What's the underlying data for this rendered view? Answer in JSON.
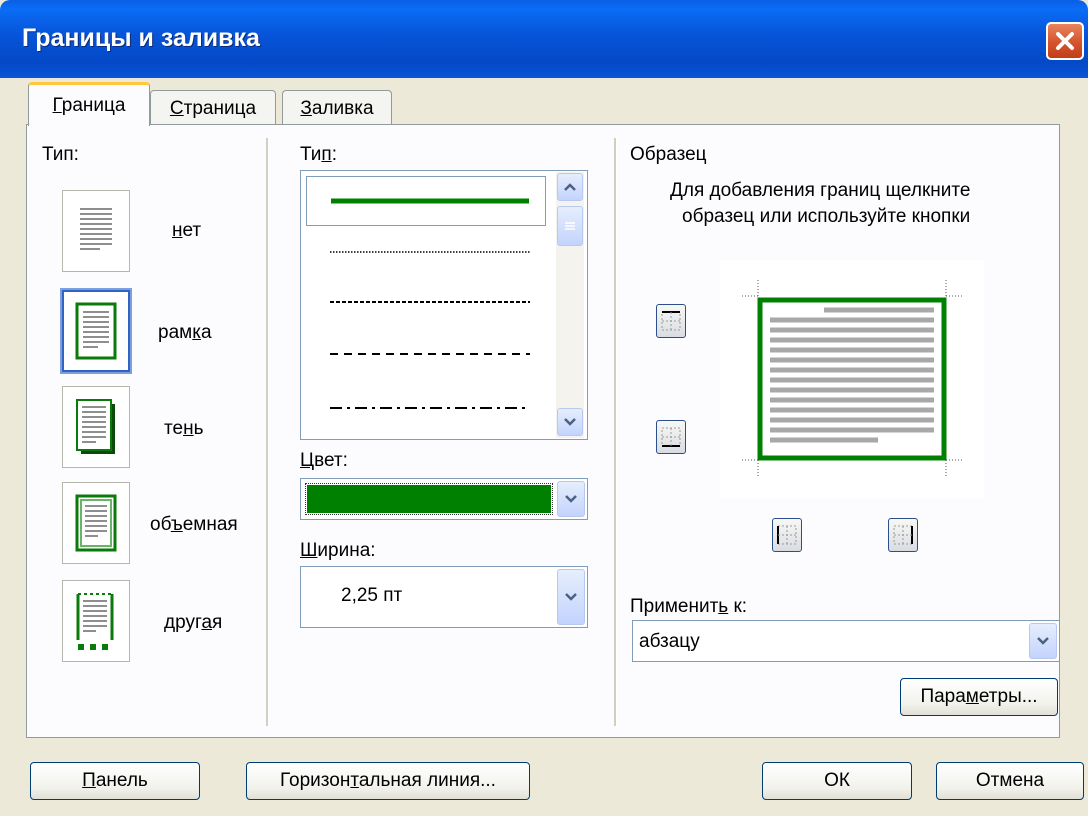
{
  "window": {
    "title": "Границы и заливка"
  },
  "tabs": [
    {
      "label": "Граница",
      "hotkey": "Г",
      "rest": "раница",
      "active": true
    },
    {
      "label": "Страница",
      "hotkey": "С",
      "rest": "траница",
      "active": false
    },
    {
      "label": "Заливка",
      "hotkey": "З",
      "rest": "аливка",
      "active": false
    }
  ],
  "setting": {
    "label": "Тип:",
    "presets": [
      {
        "name": "нет",
        "pre": "",
        "hotkey": "н",
        "post": "ет",
        "selected": false,
        "icon": "page-none-icon"
      },
      {
        "name": "рамка",
        "pre": "рам",
        "hotkey": "к",
        "post": "а",
        "selected": true,
        "icon": "page-box-icon"
      },
      {
        "name": "тень",
        "pre": "те",
        "hotkey": "н",
        "post": "ь",
        "selected": false,
        "icon": "page-shadow-icon"
      },
      {
        "name": "объемная",
        "pre": "об",
        "hotkey": "ъ",
        "post": "емная",
        "selected": false,
        "icon": "page-3d-icon"
      },
      {
        "name": "другая",
        "pre": "друг",
        "hotkey": "а",
        "post": "я",
        "selected": false,
        "icon": "page-custom-icon"
      }
    ]
  },
  "style": {
    "label": "Тип:",
    "label_pre": "Ти",
    "label_hotkey": "п",
    "label_post": ":",
    "options": [
      "solid",
      "dotted",
      "dashed-small",
      "dashed",
      "dash-dot"
    ],
    "selected": "solid"
  },
  "color": {
    "label": "Цвет:",
    "hotkey": "Ц",
    "rest": "вет:",
    "value_hex": "#008000"
  },
  "width": {
    "label": "Ширина:",
    "hotkey": "Ш",
    "rest": "ирина:",
    "value": "2,25 пт"
  },
  "preview": {
    "title": "Образец",
    "hint": "Для добавления границ щелкните образец или используйте кнопки",
    "hint_line1": "Для добавления границ щелкните",
    "hint_line2": "образец или используйте кнопки",
    "border_color": "#008000"
  },
  "apply_to": {
    "label": "Применить к:",
    "pre": "Применит",
    "hotkey": "ь",
    "post": " к:",
    "value": "абзацу"
  },
  "buttons": {
    "options": {
      "label": "Параметры...",
      "pre": "Пара",
      "hotkey": "м",
      "post": "етры..."
    },
    "toolbar": {
      "label": "Панель",
      "hotkey": "П",
      "rest": "анель"
    },
    "horizontal_line": {
      "label": "Горизонтальная линия...",
      "pre": "Горизон",
      "hotkey": "т",
      "post": "альная линия..."
    },
    "ok": "ОК",
    "cancel": "Отмена"
  },
  "colors": {
    "titlebar": "#0054E3",
    "face": "#ECE9D8",
    "accent_border": "#008000"
  }
}
